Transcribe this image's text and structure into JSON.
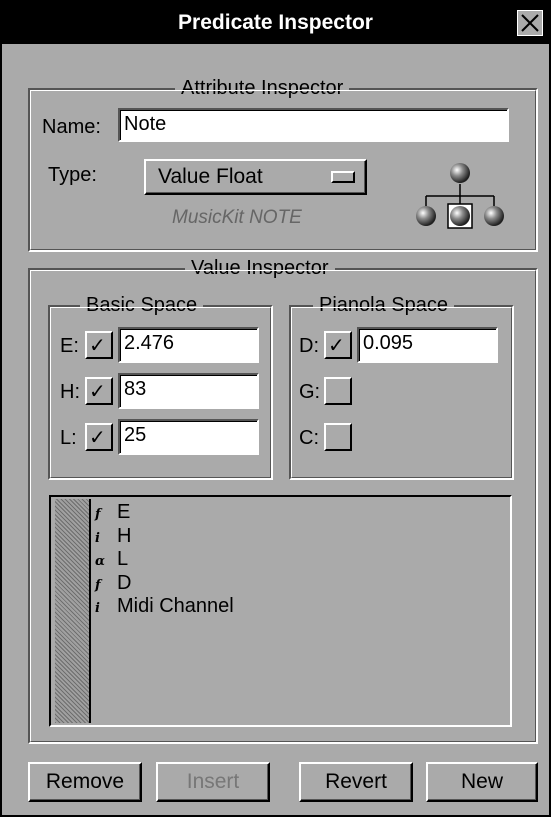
{
  "window": {
    "title": "Predicate Inspector"
  },
  "attribute_inspector": {
    "legend": "Attribute Inspector",
    "name_label": "Name:",
    "name_value": "Note",
    "type_label": "Type:",
    "type_value": "Value Float",
    "class_note": "MusicKit NOTE"
  },
  "value_inspector": {
    "legend": "Value Inspector",
    "basic_space": {
      "legend": "Basic Space",
      "rows": [
        {
          "label": "E:",
          "checked": true,
          "value": "2.476"
        },
        {
          "label": "H:",
          "checked": true,
          "value": "83"
        },
        {
          "label": "L:",
          "checked": true,
          "value": "25"
        }
      ]
    },
    "pianola_space": {
      "legend": "Pianola Space",
      "rows": [
        {
          "label": "D:",
          "checked": true,
          "value": "0.095"
        },
        {
          "label": "G:",
          "checked": false
        },
        {
          "label": "C:",
          "checked": false
        }
      ]
    },
    "list": [
      {
        "type_glyph": "f",
        "name": "E"
      },
      {
        "type_glyph": "i",
        "name": "H"
      },
      {
        "type_glyph": "α",
        "name": "L"
      },
      {
        "type_glyph": "f",
        "name": "D"
      },
      {
        "type_glyph": "i",
        "name": "Midi Channel"
      }
    ]
  },
  "buttons": {
    "remove": "Remove",
    "insert": "Insert",
    "revert": "Revert",
    "new": "New"
  },
  "icons": {
    "close": "close-icon",
    "popup": "popup-menu-icon",
    "hierarchy": "hierarchy-tree-icon",
    "check": "check-icon"
  },
  "colors": {
    "panel": "#aaaaaa",
    "titlebar": "#000000",
    "title_text": "#ffffff",
    "field": "#ffffff"
  }
}
